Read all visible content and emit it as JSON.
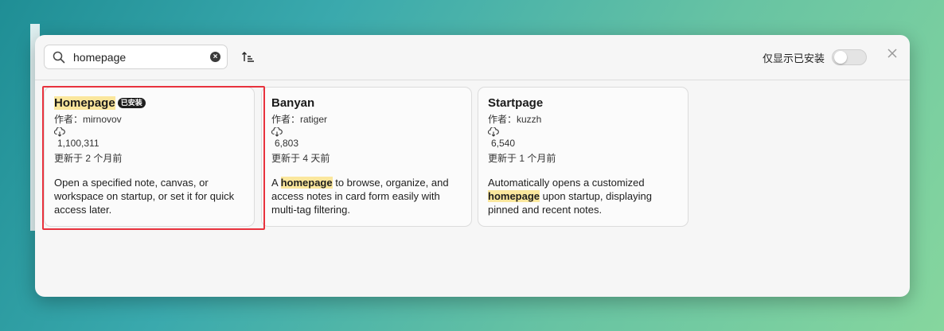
{
  "search": {
    "value": "homepage",
    "placeholder": ""
  },
  "filter": {
    "installed_only_label": "仅显示已安装",
    "installed_only_on": false
  },
  "plugins": [
    {
      "name": "Homepage",
      "installed_badge": "已安装",
      "author": "作者：mirnovov",
      "downloads": "1,100,311",
      "updated": "更新于 2 个月前",
      "description": "Open a specified note, canvas, or workspace on startup, or set it for quick access later."
    },
    {
      "name": "Banyan",
      "author": "作者：ratiger",
      "downloads": "6,803",
      "updated": "更新于 4 天前",
      "description_before": "A ",
      "description_highlight": "homepage",
      "description_after": " to browse, organize, and access notes in card form easily with multi-tag filtering."
    },
    {
      "name": "Startpage",
      "author": "作者：kuzzh",
      "downloads": "6,540",
      "updated": "更新于 1 个月前",
      "description_before": "Automatically opens a customized ",
      "description_highlight": "homepage",
      "description_after": " upon startup, displaying pinned and recent notes."
    }
  ],
  "colors": {
    "highlight": "#fbe79d",
    "selection_box": "#e8323d",
    "badge": "#1e1e1e"
  },
  "icons": [
    "search-icon",
    "clear-icon",
    "sort-icon",
    "close-icon",
    "download-icon"
  ]
}
